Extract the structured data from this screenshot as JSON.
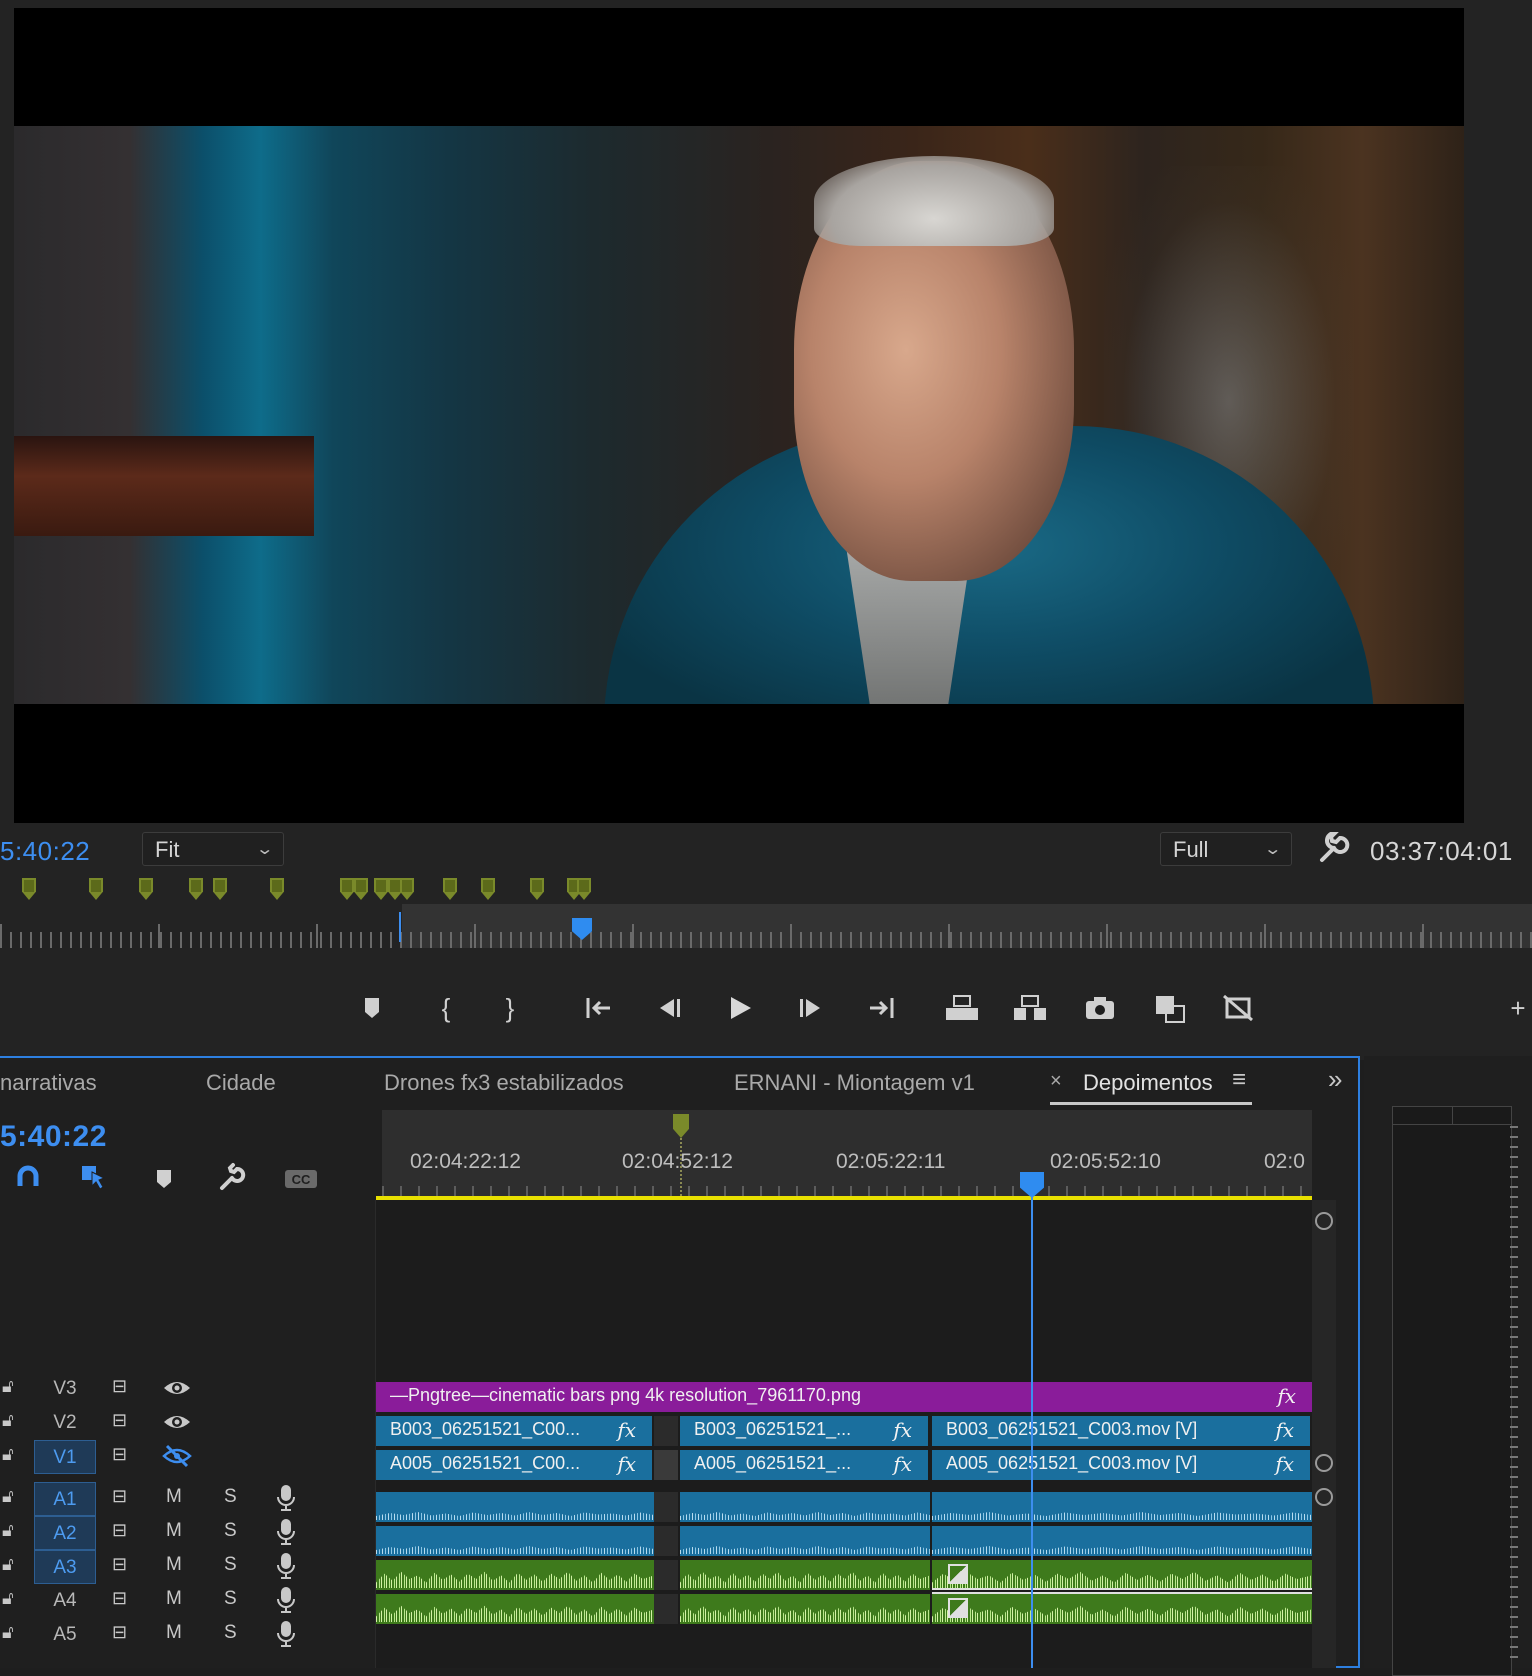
{
  "program_monitor": {
    "playhead_timecode": "5:40:22",
    "zoom_select": "Fit",
    "resolution_select": "Full",
    "duration_timecode": "03:37:04:01"
  },
  "transport_buttons": [
    {
      "name": "add-marker-button",
      "glyph": "⬟"
    },
    {
      "name": "mark-in-button",
      "glyph": "{"
    },
    {
      "name": "mark-out-button",
      "glyph": "}"
    },
    {
      "name": "go-to-in-button",
      "glyph": "{⇤"
    },
    {
      "name": "step-back-button",
      "glyph": "◀|"
    },
    {
      "name": "play-button",
      "glyph": "▶"
    },
    {
      "name": "step-forward-button",
      "glyph": "|▶"
    },
    {
      "name": "go-to-out-button",
      "glyph": "⇥}"
    },
    {
      "name": "lift-button",
      "glyph": "⬒"
    },
    {
      "name": "extract-button",
      "glyph": "⬓"
    },
    {
      "name": "export-frame-button",
      "glyph": "📷"
    },
    {
      "name": "comparison-view-button",
      "glyph": "▤"
    },
    {
      "name": "toggle-proxies-button",
      "glyph": "⊠"
    },
    {
      "name": "add-button",
      "glyph": "+"
    }
  ],
  "timeline": {
    "tabs": [
      {
        "label": "narrativas"
      },
      {
        "label": "Cidade"
      },
      {
        "label": "Drones fx3 estabilizados"
      },
      {
        "label": "ERNANI - Miontagem v1"
      },
      {
        "label": "Depoimentos",
        "active": true
      }
    ],
    "close_glyph": "×",
    "menu_glyph": "≡",
    "overflow_glyph": "»",
    "sequence_timecode": "5:40:22",
    "ruler_labels": [
      "02:04:22:12",
      "02:04:52:12",
      "02:05:22:11",
      "02:05:52:10",
      "02:0"
    ],
    "tracks": {
      "video": [
        {
          "name": "V3"
        },
        {
          "name": "V2"
        },
        {
          "name": "V1",
          "active": true,
          "hidden": true
        }
      ],
      "audio": [
        {
          "name": "A1",
          "active": true
        },
        {
          "name": "A2",
          "active": true
        },
        {
          "name": "A3",
          "active": true
        },
        {
          "name": "A4"
        },
        {
          "name": "A5"
        }
      ],
      "mute_label": "M",
      "solo_label": "S"
    },
    "clips": {
      "v3": "—Pngtree—cinematic bars png 4k resolution_7961170.png",
      "v2": [
        "B003_06251521_C00...",
        "B003_06251521_...",
        "B003_06251521_C003.mov [V]"
      ],
      "v1": [
        "A005_06251521_C00...",
        "A005_06251521_...",
        "A005_06251521_C003.mov [V]"
      ],
      "fx_label": "fx"
    }
  }
}
